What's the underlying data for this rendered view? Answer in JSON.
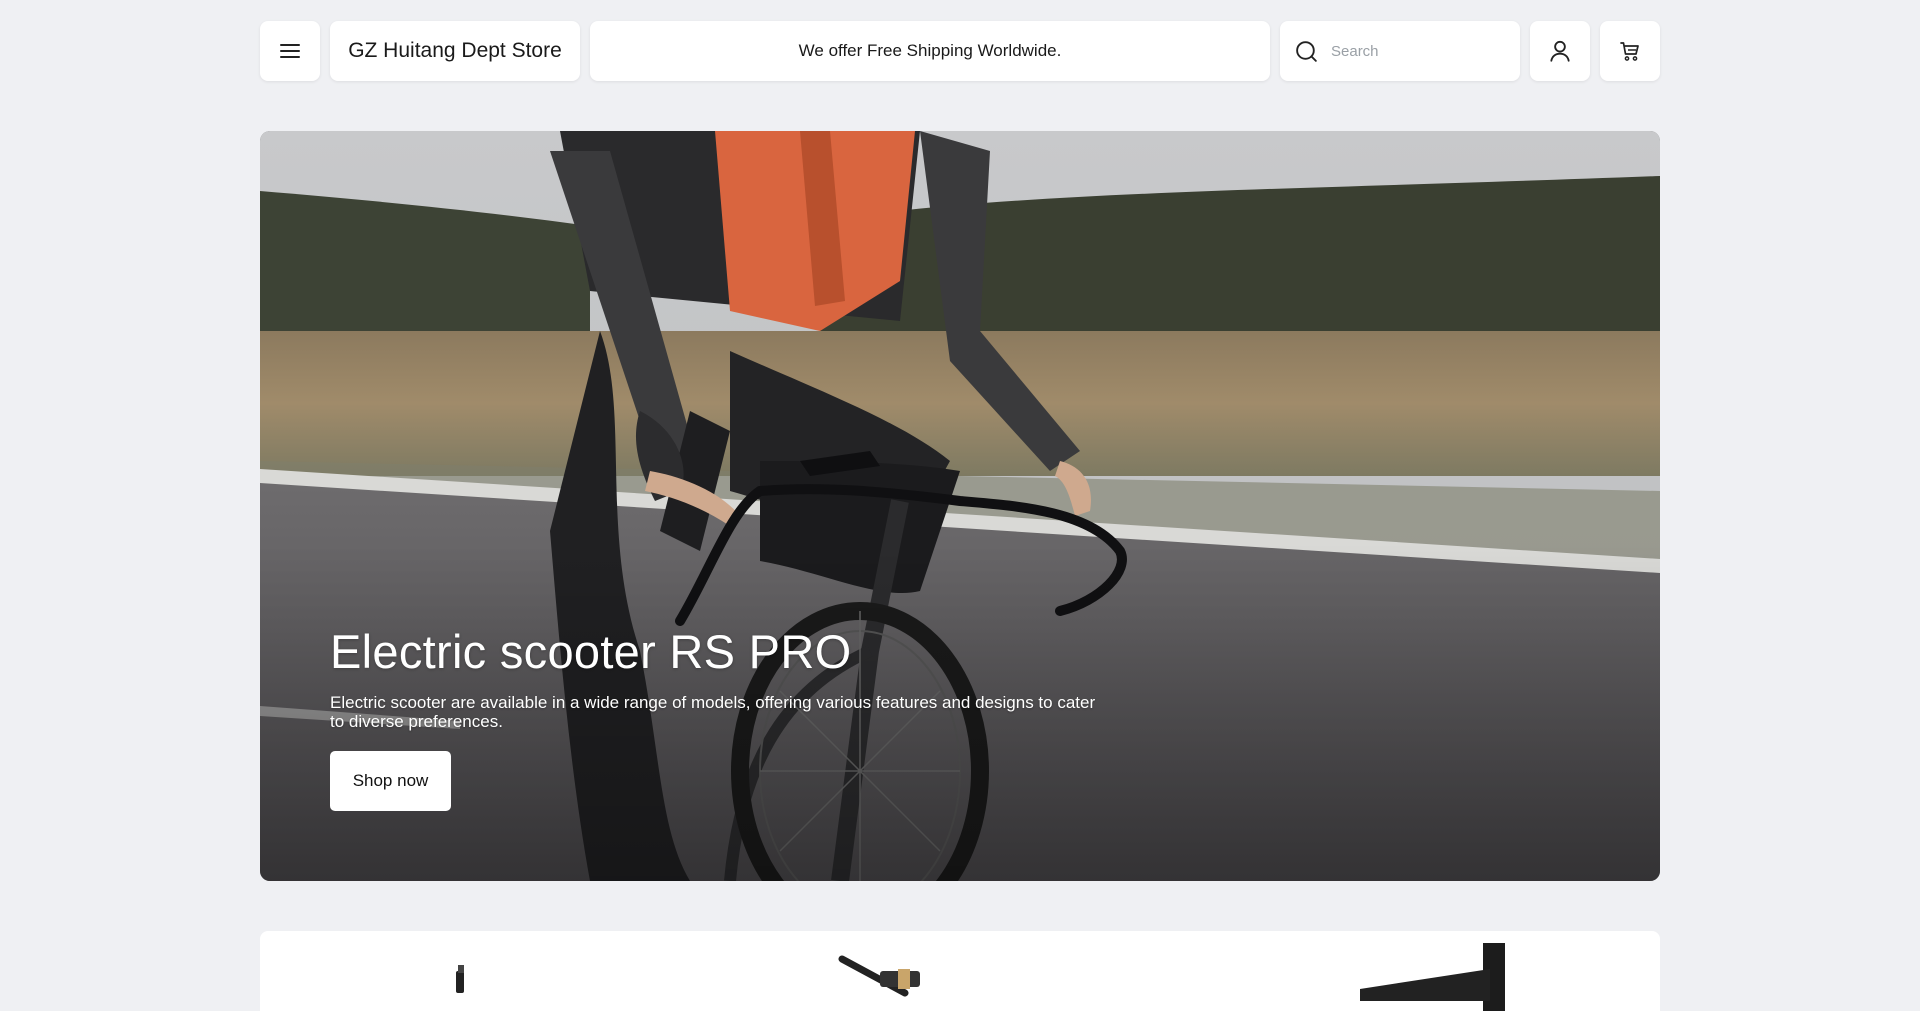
{
  "header": {
    "brand": "GZ Huitang Dept Store",
    "announcement": "We offer Free Shipping Worldwide.",
    "search_placeholder": "Search",
    "icons": [
      "menu-icon",
      "search-icon",
      "user-icon",
      "cart-icon"
    ]
  },
  "hero": {
    "title": "Electric scooter RS PRO",
    "description": "Electric scooter are available in a wide range of models, offering various features and designs to cater to diverse preferences.",
    "cta_label": "Shop now"
  },
  "colors": {
    "page_bg": "#eff0f3",
    "card_bg": "#ffffff",
    "text": "#1a1a1a",
    "jersey_accent": "#d9653f"
  }
}
